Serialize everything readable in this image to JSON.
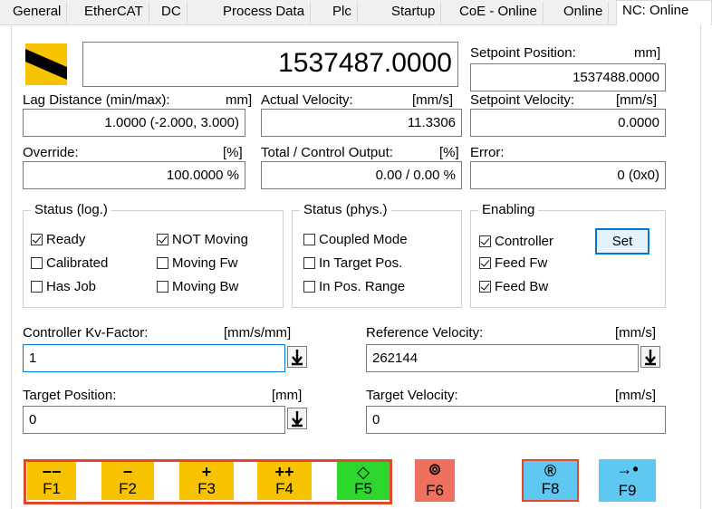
{
  "tabs": [
    "General",
    "EtherCAT",
    "DC",
    "Process Data",
    "Plc",
    "Startup",
    "CoE - Online",
    "Online",
    "NC: Online"
  ],
  "main": {
    "big_value": "1537487.0000"
  },
  "setpoint_position": {
    "label": "Setpoint Position:",
    "unit": "mm]",
    "value": "1537488.0000"
  },
  "lag_distance": {
    "label": "Lag Distance (min/max):",
    "unit": "mm]",
    "value": "1.0000  (-2.000, 3.000)"
  },
  "actual_velocity": {
    "label": "Actual Velocity:",
    "unit": "[mm/s]",
    "value": "11.3306"
  },
  "setpoint_velocity": {
    "label": "Setpoint Velocity:",
    "unit": "[mm/s]",
    "value": "0.0000"
  },
  "override": {
    "label": "Override:",
    "unit": "[%]",
    "value": "100.0000 %"
  },
  "total_output": {
    "label": "Total / Control Output:",
    "unit": "[%]",
    "value": "0.00 /  0.00 %"
  },
  "error": {
    "label": "Error:",
    "value": "0 (0x0)"
  },
  "status_log": {
    "title": "Status (log.)",
    "items": [
      {
        "label": "Ready",
        "checked": true
      },
      {
        "label": "NOT Moving",
        "checked": true
      },
      {
        "label": "Calibrated",
        "checked": false
      },
      {
        "label": "Moving Fw",
        "checked": false
      },
      {
        "label": "Has Job",
        "checked": false
      },
      {
        "label": "Moving Bw",
        "checked": false
      }
    ]
  },
  "status_phys": {
    "title": "Status (phys.)",
    "items": [
      {
        "label": "Coupled Mode",
        "checked": false
      },
      {
        "label": "In Target Pos.",
        "checked": false
      },
      {
        "label": "In Pos. Range",
        "checked": false
      }
    ]
  },
  "enabling": {
    "title": "Enabling",
    "items": [
      {
        "label": "Controller",
        "checked": true
      },
      {
        "label": "Feed Fw",
        "checked": true
      },
      {
        "label": "Feed Bw",
        "checked": true
      }
    ],
    "set_label": "Set"
  },
  "kv_factor": {
    "label": "Controller Kv-Factor:",
    "unit": "[mm/s/mm]",
    "value": "1"
  },
  "ref_velocity": {
    "label": "Reference Velocity:",
    "unit": "[mm/s]",
    "value": "262144"
  },
  "target_position": {
    "label": "Target Position:",
    "unit": "[mm]",
    "value": "0"
  },
  "target_velocity": {
    "label": "Target Velocity:",
    "unit": "[mm/s]",
    "value": "0"
  },
  "fkeys": [
    {
      "symbol": "−−",
      "label": "F1",
      "color": "#f7c300"
    },
    {
      "symbol": "−",
      "label": "F2",
      "color": "#f7c300"
    },
    {
      "symbol": "+",
      "label": "F3",
      "color": "#f7c300"
    },
    {
      "symbol": "++",
      "label": "F4",
      "color": "#f7c300"
    },
    {
      "symbol": "◇",
      "label": "F5",
      "color": "#2dd62d"
    },
    {
      "symbol": "⊚",
      "label": "F6",
      "color": "#f07060"
    },
    {
      "symbol": "®",
      "label": "F8",
      "color": "#5ec8f0"
    },
    {
      "symbol": "→•",
      "label": "F9",
      "color": "#5ec8f0"
    }
  ],
  "colors": {
    "accent": "#0078d7",
    "highlight_border": "#e0472b"
  }
}
